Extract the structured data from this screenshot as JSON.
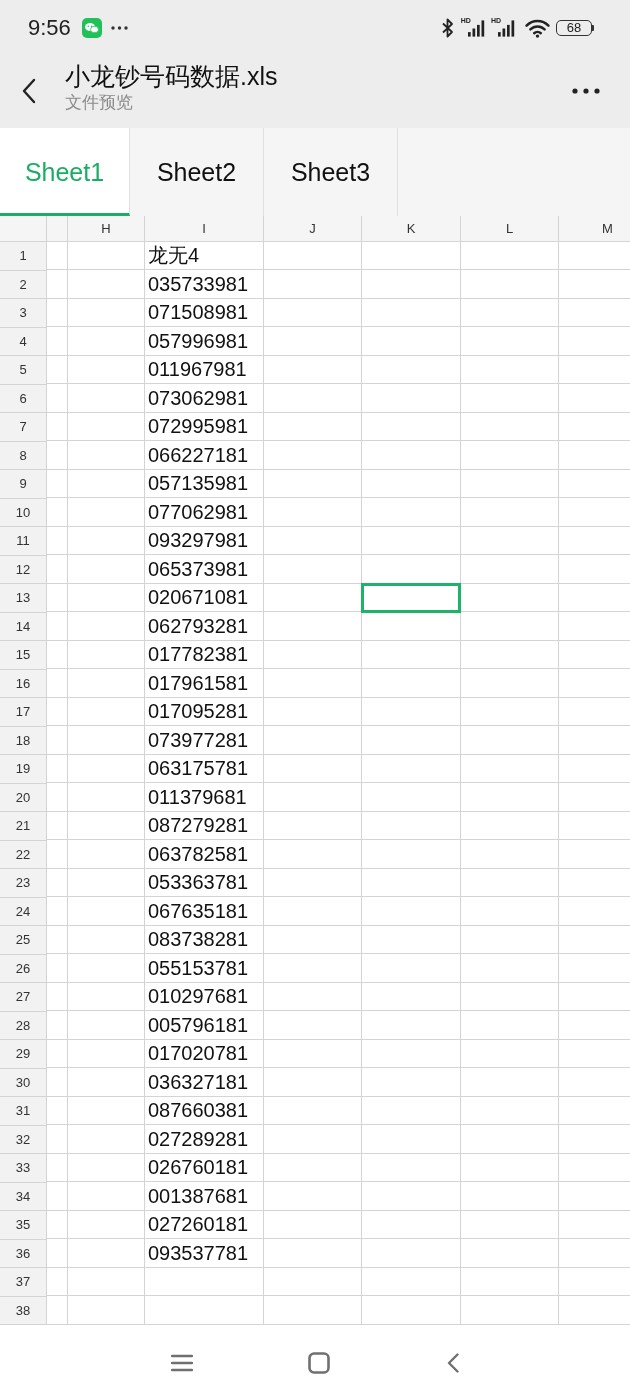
{
  "status_bar": {
    "time": "9:56",
    "networks": [
      {
        "label": "HD"
      },
      {
        "label": "HD"
      }
    ],
    "battery": "68"
  },
  "app_bar": {
    "title": "小龙钞号码数据.xls",
    "subtitle": "文件预览"
  },
  "tabs": [
    {
      "label": "Sheet1",
      "selected": true
    },
    {
      "label": "Sheet2",
      "selected": false
    },
    {
      "label": "Sheet3",
      "selected": false
    }
  ],
  "sheet": {
    "columns": [
      "H",
      "I",
      "J",
      "K",
      "L",
      "M"
    ],
    "rows": [
      {
        "number": "1",
        "cells": [
          {
            "selected": false
          },
          {
            "text": "龙无4",
            "selected": false
          },
          {
            "selected": false
          },
          {
            "selected": false
          },
          {
            "selected": false
          },
          {
            "selected": false
          }
        ]
      },
      {
        "number": "2",
        "cells": [
          {
            "selected": false
          },
          {
            "text": "035733981",
            "selected": false
          },
          {
            "selected": false
          },
          {
            "selected": false
          },
          {
            "selected": false
          },
          {
            "selected": false
          }
        ]
      },
      {
        "number": "3",
        "cells": [
          {
            "selected": false
          },
          {
            "text": "071508981",
            "selected": false
          },
          {
            "selected": false
          },
          {
            "selected": false
          },
          {
            "selected": false
          },
          {
            "selected": false
          }
        ]
      },
      {
        "number": "4",
        "cells": [
          {
            "selected": false
          },
          {
            "text": "057996981",
            "selected": false
          },
          {
            "selected": false
          },
          {
            "selected": false
          },
          {
            "selected": false
          },
          {
            "selected": false
          }
        ]
      },
      {
        "number": "5",
        "cells": [
          {
            "selected": false
          },
          {
            "text": "011967981",
            "selected": false
          },
          {
            "selected": false
          },
          {
            "selected": false
          },
          {
            "selected": false
          },
          {
            "selected": false
          }
        ]
      },
      {
        "number": "6",
        "cells": [
          {
            "selected": false
          },
          {
            "text": "073062981",
            "selected": false
          },
          {
            "selected": false
          },
          {
            "selected": false
          },
          {
            "selected": false
          },
          {
            "selected": false
          }
        ]
      },
      {
        "number": "7",
        "cells": [
          {
            "selected": false
          },
          {
            "text": "072995981",
            "selected": false
          },
          {
            "selected": false
          },
          {
            "selected": false
          },
          {
            "selected": false
          },
          {
            "selected": false
          }
        ]
      },
      {
        "number": "8",
        "cells": [
          {
            "selected": false
          },
          {
            "text": "066227181",
            "selected": false
          },
          {
            "selected": false
          },
          {
            "selected": false
          },
          {
            "selected": false
          },
          {
            "selected": false
          }
        ]
      },
      {
        "number": "9",
        "cells": [
          {
            "selected": false
          },
          {
            "text": "057135981",
            "selected": false
          },
          {
            "selected": false
          },
          {
            "selected": false
          },
          {
            "selected": false
          },
          {
            "selected": false
          }
        ]
      },
      {
        "number": "10",
        "cells": [
          {
            "selected": false
          },
          {
            "text": "077062981",
            "selected": false
          },
          {
            "selected": false
          },
          {
            "selected": false
          },
          {
            "selected": false
          },
          {
            "selected": false
          }
        ]
      },
      {
        "number": "11",
        "cells": [
          {
            "selected": false
          },
          {
            "text": "093297981",
            "selected": false
          },
          {
            "selected": false
          },
          {
            "selected": false
          },
          {
            "selected": false
          },
          {
            "selected": false
          }
        ]
      },
      {
        "number": "12",
        "cells": [
          {
            "selected": false
          },
          {
            "text": "065373981",
            "selected": false
          },
          {
            "selected": false
          },
          {
            "selected": false
          },
          {
            "selected": false
          },
          {
            "selected": false
          }
        ]
      },
      {
        "number": "13",
        "cells": [
          {
            "selected": false
          },
          {
            "text": "020671081",
            "selected": false
          },
          {
            "selected": false
          },
          {
            "selected": true
          },
          {
            "selected": false
          },
          {
            "selected": false
          }
        ]
      },
      {
        "number": "14",
        "cells": [
          {
            "selected": false
          },
          {
            "text": "062793281",
            "selected": false
          },
          {
            "selected": false
          },
          {
            "selected": false
          },
          {
            "selected": false
          },
          {
            "selected": false
          }
        ]
      },
      {
        "number": "15",
        "cells": [
          {
            "selected": false
          },
          {
            "text": "017782381",
            "selected": false
          },
          {
            "selected": false
          },
          {
            "selected": false
          },
          {
            "selected": false
          },
          {
            "selected": false
          }
        ]
      },
      {
        "number": "16",
        "cells": [
          {
            "selected": false
          },
          {
            "text": "017961581",
            "selected": false
          },
          {
            "selected": false
          },
          {
            "selected": false
          },
          {
            "selected": false
          },
          {
            "selected": false
          }
        ]
      },
      {
        "number": "17",
        "cells": [
          {
            "selected": false
          },
          {
            "text": "017095281",
            "selected": false
          },
          {
            "selected": false
          },
          {
            "selected": false
          },
          {
            "selected": false
          },
          {
            "selected": false
          }
        ]
      },
      {
        "number": "18",
        "cells": [
          {
            "selected": false
          },
          {
            "text": "073977281",
            "selected": false
          },
          {
            "selected": false
          },
          {
            "selected": false
          },
          {
            "selected": false
          },
          {
            "selected": false
          }
        ]
      },
      {
        "number": "19",
        "cells": [
          {
            "selected": false
          },
          {
            "text": "063175781",
            "selected": false
          },
          {
            "selected": false
          },
          {
            "selected": false
          },
          {
            "selected": false
          },
          {
            "selected": false
          }
        ]
      },
      {
        "number": "20",
        "cells": [
          {
            "selected": false
          },
          {
            "text": "011379681",
            "selected": false
          },
          {
            "selected": false
          },
          {
            "selected": false
          },
          {
            "selected": false
          },
          {
            "selected": false
          }
        ]
      },
      {
        "number": "21",
        "cells": [
          {
            "selected": false
          },
          {
            "text": "087279281",
            "selected": false
          },
          {
            "selected": false
          },
          {
            "selected": false
          },
          {
            "selected": false
          },
          {
            "selected": false
          }
        ]
      },
      {
        "number": "22",
        "cells": [
          {
            "selected": false
          },
          {
            "text": "063782581",
            "selected": false
          },
          {
            "selected": false
          },
          {
            "selected": false
          },
          {
            "selected": false
          },
          {
            "selected": false
          }
        ]
      },
      {
        "number": "23",
        "cells": [
          {
            "selected": false
          },
          {
            "text": "053363781",
            "selected": false
          },
          {
            "selected": false
          },
          {
            "selected": false
          },
          {
            "selected": false
          },
          {
            "selected": false
          }
        ]
      },
      {
        "number": "24",
        "cells": [
          {
            "selected": false
          },
          {
            "text": "067635181",
            "selected": false
          },
          {
            "selected": false
          },
          {
            "selected": false
          },
          {
            "selected": false
          },
          {
            "selected": false
          }
        ]
      },
      {
        "number": "25",
        "cells": [
          {
            "selected": false
          },
          {
            "text": "083738281",
            "selected": false
          },
          {
            "selected": false
          },
          {
            "selected": false
          },
          {
            "selected": false
          },
          {
            "selected": false
          }
        ]
      },
      {
        "number": "26",
        "cells": [
          {
            "selected": false
          },
          {
            "text": "055153781",
            "selected": false
          },
          {
            "selected": false
          },
          {
            "selected": false
          },
          {
            "selected": false
          },
          {
            "selected": false
          }
        ]
      },
      {
        "number": "27",
        "cells": [
          {
            "selected": false
          },
          {
            "text": "010297681",
            "selected": false
          },
          {
            "selected": false
          },
          {
            "selected": false
          },
          {
            "selected": false
          },
          {
            "selected": false
          }
        ]
      },
      {
        "number": "28",
        "cells": [
          {
            "selected": false
          },
          {
            "text": "005796181",
            "selected": false
          },
          {
            "selected": false
          },
          {
            "selected": false
          },
          {
            "selected": false
          },
          {
            "selected": false
          }
        ]
      },
      {
        "number": "29",
        "cells": [
          {
            "selected": false
          },
          {
            "text": "017020781",
            "selected": false
          },
          {
            "selected": false
          },
          {
            "selected": false
          },
          {
            "selected": false
          },
          {
            "selected": false
          }
        ]
      },
      {
        "number": "30",
        "cells": [
          {
            "selected": false
          },
          {
            "text": "036327181",
            "selected": false
          },
          {
            "selected": false
          },
          {
            "selected": false
          },
          {
            "selected": false
          },
          {
            "selected": false
          }
        ]
      },
      {
        "number": "31",
        "cells": [
          {
            "selected": false
          },
          {
            "text": "087660381",
            "selected": false
          },
          {
            "selected": false
          },
          {
            "selected": false
          },
          {
            "selected": false
          },
          {
            "selected": false
          }
        ]
      },
      {
        "number": "32",
        "cells": [
          {
            "selected": false
          },
          {
            "text": "027289281",
            "selected": false
          },
          {
            "selected": false
          },
          {
            "selected": false
          },
          {
            "selected": false
          },
          {
            "selected": false
          }
        ]
      },
      {
        "number": "33",
        "cells": [
          {
            "selected": false
          },
          {
            "text": "026760181",
            "selected": false
          },
          {
            "selected": false
          },
          {
            "selected": false
          },
          {
            "selected": false
          },
          {
            "selected": false
          }
        ]
      },
      {
        "number": "34",
        "cells": [
          {
            "selected": false
          },
          {
            "text": "001387681",
            "selected": false
          },
          {
            "selected": false
          },
          {
            "selected": false
          },
          {
            "selected": false
          },
          {
            "selected": false
          }
        ]
      },
      {
        "number": "35",
        "cells": [
          {
            "selected": false
          },
          {
            "text": "027260181",
            "selected": false
          },
          {
            "selected": false
          },
          {
            "selected": false
          },
          {
            "selected": false
          },
          {
            "selected": false
          }
        ]
      },
      {
        "number": "36",
        "cells": [
          {
            "selected": false
          },
          {
            "text": "093537781",
            "selected": false
          },
          {
            "selected": false
          },
          {
            "selected": false
          },
          {
            "selected": false
          },
          {
            "selected": false
          }
        ]
      },
      {
        "number": "37",
        "cells": [
          {
            "selected": false
          },
          {
            "selected": false
          },
          {
            "selected": false
          },
          {
            "selected": false
          },
          {
            "selected": false
          },
          {
            "selected": false
          }
        ]
      },
      {
        "number": "38",
        "cells": [
          {
            "selected": false
          },
          {
            "selected": false
          },
          {
            "selected": false
          },
          {
            "selected": false
          },
          {
            "selected": false
          },
          {
            "selected": false
          }
        ]
      }
    ]
  }
}
